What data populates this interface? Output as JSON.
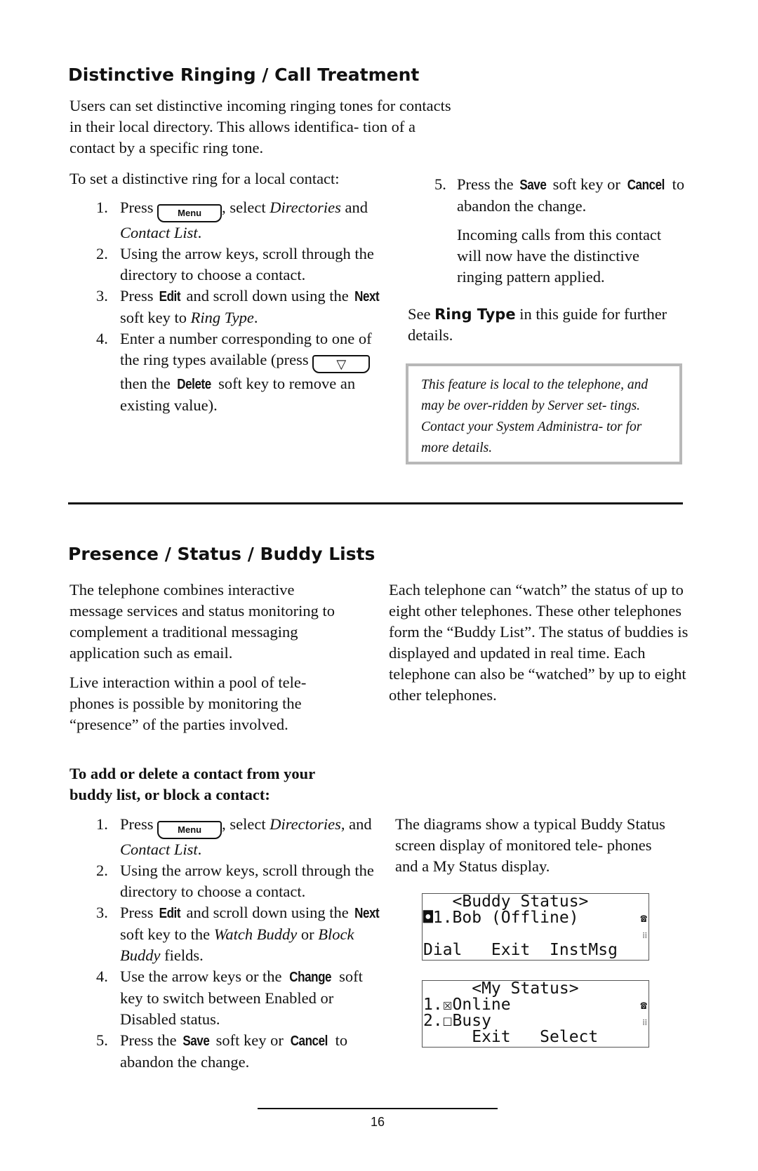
{
  "section1": {
    "title": "Distinctive Ringing / Call Treatment",
    "intro": "Users can set distinctive incoming ringing tones for contacts in their local directory.  This allows identifica- tion of a contact by a specific ring tone.",
    "lead": "To set a distinctive ring for a local contact:",
    "steps": [
      {
        "n": "1.",
        "a": "Press ",
        "key": "Menu",
        "b": ", select ",
        "i1": "Directories",
        "c": " and ",
        "i2": "Contact List",
        "d": "."
      },
      {
        "n": "2.",
        "text": "Using the arrow keys, scroll through the directory to choose a contact."
      },
      {
        "n": "3.",
        "a": "Press ",
        "sk1": "Edit",
        "b": " and scroll down using the ",
        "sk2": "Next",
        "c": " soft key to ",
        "i1": "Ring Type",
        "d": "."
      },
      {
        "n": "4.",
        "a": "Enter a number corresponding to one of the ring types available (press ",
        "key": "▽",
        "b": " then the ",
        "sk1": "Delete",
        "c": " soft key to remove an existing value)."
      },
      {
        "n": "5.",
        "a": "Press the ",
        "sk1": "Save",
        "b": " soft key or ",
        "sk2": "Cancel",
        "c": " to abandon the change."
      }
    ],
    "result": "Incoming calls from this contact will now have the distinctive ringing pattern applied.",
    "see_a": "See ",
    "see_b": "Ring Type",
    "see_c": " in this guide for further details.",
    "note": "This feature is local to the telephone, and may be over-ridden by Server set- tings.  Contact your System Administra- tor for more details."
  },
  "section2": {
    "title": "Presence / Status / Buddy Lists",
    "p1": "The telephone combines interactive message services and status monitoring to complement a traditional messaging application such as email.",
    "p2": "Live interaction within a pool of tele- phones is possible by monitoring the “presence” of the parties involved.",
    "p3": "Each telephone can “watch” the status of up to eight other telephones.  These other telephones form the “Buddy List”.  The status of buddies is displayed and updated in real time.  Each telephone can also be “watched” by up to eight other telephones.",
    "lead": "To add or delete a contact from your buddy list, or block a contact:",
    "steps": [
      {
        "n": "1.",
        "a": "Press ",
        "key": "Menu",
        "b": ", select ",
        "i1": "Directories,",
        "c": " and ",
        "i2": "Contact List",
        "d": "."
      },
      {
        "n": "2.",
        "text": "Using the arrow keys, scroll through the directory to choose a contact."
      },
      {
        "n": "3.",
        "a": "Press ",
        "sk1": "Edit",
        "b": " and scroll down using the ",
        "sk2": "Next",
        "c": " soft key to the ",
        "i1": "Watch Buddy",
        "d": " or ",
        "i2": "Block Buddy",
        "e": " fields."
      },
      {
        "n": "4.",
        "a": "Use the arrow keys or the ",
        "sk1": "Change",
        "b": " soft key to switch between Enabled or Disabled status."
      },
      {
        "n": "5.",
        "a": "Press the ",
        "sk1": "Save",
        "b": " soft key or ",
        "sk2": "Cancel",
        "c": " to abandon the change."
      }
    ],
    "diagram_caption": "The diagrams show a typical Buddy Status screen display of monitored tele- phones and a My Status display.",
    "lcd_buddy": {
      "title": "   <Buddy Status>",
      "line1": "◘1.Bob (Offline)",
      "softkeys": "Dial   Exit  InstMsg"
    },
    "lcd_my": {
      "title": "     <My Status>",
      "line1": "1.☒Online",
      "line2": "2.☐Busy",
      "softkeys": "     Exit   Select"
    }
  },
  "footer": {
    "page_number": "16"
  }
}
